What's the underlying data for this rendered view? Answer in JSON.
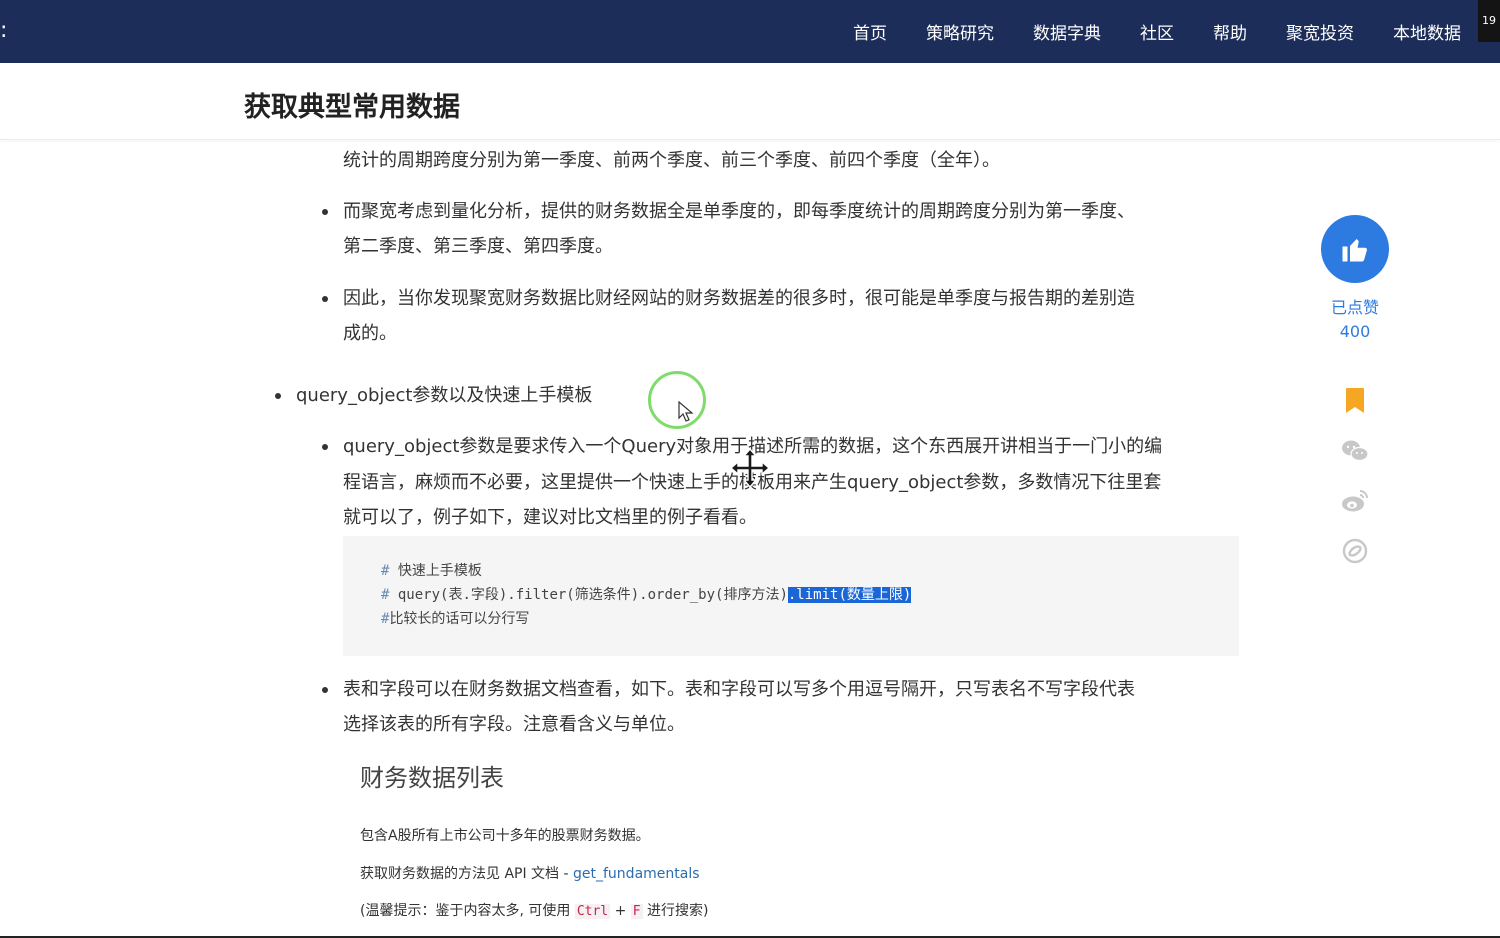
{
  "nav": {
    "left_mark": ":",
    "items": [
      "首页",
      "策略研究",
      "数据字典",
      "社区",
      "帮助",
      "聚宽投资",
      "本地数据"
    ],
    "badge": "19"
  },
  "header": {
    "title": "获取典型常用数据"
  },
  "article": {
    "lines": {
      "l1": "统计的周期跨度分别为第一季度、前两个季度、前三个季度、前四个季度（全年）。",
      "l2": "而聚宽考虑到量化分析，提供的财务数据全是单季度的，即每季度统计的周期跨度分别为第一季度、",
      "l3": "第二季度、第三季度、第四季度。",
      "l4": "因此，当你发现聚宽财务数据比财经网站的财务数据差的很多时，很可能是单季度与报告期的差别造",
      "l5": "成的。",
      "l6": "query_object参数以及快速上手模板",
      "l7": "query_object参数是要求传入一个Query对象用于描述所需的数据，这个东西展开讲相当于一门小的编",
      "l8": "程语言，麻烦而不必要，这里提供一个快速上手的模板用来产生query_object参数，多数情况下往里套",
      "l9": "就可以了，例子如下，建议对比文档里的例子看看。",
      "l10": "表和字段可以在财务数据文档查看，如下。表和字段可以写多个用逗号隔开，只写表名不写字段代表",
      "l11": "选择该表的所有字段。注意看含义与单位。"
    },
    "code": {
      "line1_hash": "#",
      "line1_text": " 快速上手模板",
      "line2_hash": "#",
      "line2_text": " query(表.字段).filter(筛选条件).order_by(排序方法)",
      "line2_selected": ".limit(数量上限)",
      "line3_hash": "#",
      "line3_text": "比较长的话可以分行写"
    },
    "doc": {
      "heading": "财务数据列表",
      "desc": "包含A股所有上市公司十多年的股票财务数据。",
      "api_prefix": "获取财务数据的方法见 API 文档 - ",
      "api_link": "get_fundamentals",
      "tip_prefix": "(温馨提示：鉴于内容太多, 可使用 ",
      "tip_key1": "Ctrl",
      "tip_plus": " + ",
      "tip_key2": "F",
      "tip_suffix": " 进行搜索)"
    }
  },
  "sidebar": {
    "like_label": "已点赞",
    "like_count": "400",
    "icons": [
      "bookmark-icon",
      "wechat-icon",
      "weibo-icon",
      "share-icon"
    ]
  },
  "colors": {
    "nav_bg": "#1c2d5a",
    "accent": "#2d7be0",
    "bookmark": "#f5a623",
    "selection": "#1a66d6",
    "cursor_ring": "#7fdc6a"
  }
}
